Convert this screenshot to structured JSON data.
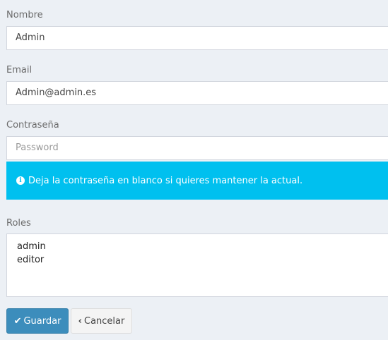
{
  "form": {
    "name": {
      "label": "Nombre",
      "value": "Admin"
    },
    "email": {
      "label": "Email",
      "value": "Admin@admin.es"
    },
    "password": {
      "label": "Contraseña",
      "placeholder": "Password"
    },
    "password_hint": "Deja la contraseña en blanco si quieres mantener la actual.",
    "roles": {
      "label": "Roles",
      "options": [
        "admin",
        "editor"
      ]
    }
  },
  "actions": {
    "save_label": "Guardar",
    "cancel_label": "Cancelar"
  },
  "icons": {
    "info": "info-circle-icon",
    "save": "check-icon",
    "cancel": "chevron-left-icon"
  },
  "colors": {
    "page_bg": "#ecf0f5",
    "alert_info": "#00c0ef",
    "primary": "#3c8dbc",
    "default_btn": "#f4f4f4"
  }
}
